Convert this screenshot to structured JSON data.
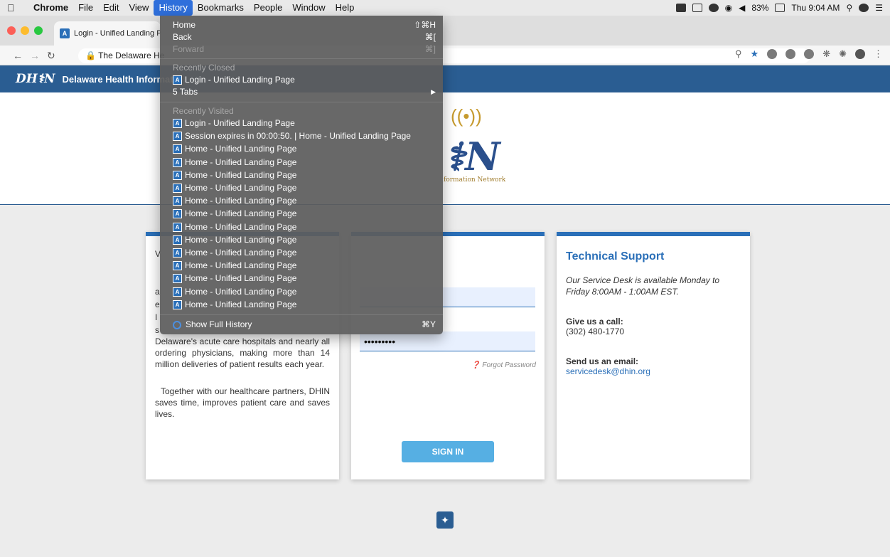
{
  "menubar": {
    "app": "Chrome",
    "items": [
      "File",
      "Edit",
      "View",
      "History",
      "Bookmarks",
      "People",
      "Window",
      "Help"
    ],
    "battery": "83%",
    "clock": "Thu 9:04 AM"
  },
  "tab": {
    "favicon": "A",
    "title": "Login - Unified Landing Page"
  },
  "omnibox": {
    "text": "The Delaware He"
  },
  "site": {
    "logo_small": "DH⚕N",
    "name": "Delaware Health Informati",
    "logo_big": "⚕N",
    "logo_sub": "formation Network"
  },
  "left_card": {
    "lines": [
      "a",
      "e",
      "I",
      "s"
    ],
    "p1": "Delaware's acute care hospitals and nearly all ordering physicians, making more than 14 million deliveries of patient results each year.",
    "p2": "Together with our healthcare partners, DHIN saves time, improves patient care and saves lives."
  },
  "login": {
    "password": "•••••••••",
    "forgot": "Forgot Password",
    "signin": "SIGN IN"
  },
  "support": {
    "title": "Technical Support",
    "hours": "Our Service Desk is available Monday to Friday 8:00AM - 1:00AM EST.",
    "call_label": "Give us a call:",
    "phone": "(302) 480-1770",
    "email_label": "Send us an email:",
    "email": "servicedesk@dhin.org"
  },
  "history_menu": {
    "home": {
      "label": "Home",
      "shortcut": "⇧⌘H"
    },
    "back": {
      "label": "Back",
      "shortcut": "⌘["
    },
    "forward": {
      "label": "Forward",
      "shortcut": "⌘]"
    },
    "recently_closed_header": "Recently Closed",
    "recently_closed": [
      "Login - Unified Landing Page"
    ],
    "tabs_group": "5 Tabs",
    "recently_visited_header": "Recently Visited",
    "recently_visited": [
      "Login - Unified Landing Page",
      "Session expires in 00:00:50. | Home - Unified Landing Page",
      "Home - Unified Landing Page",
      "Home - Unified Landing Page",
      "Home - Unified Landing Page",
      "Home - Unified Landing Page",
      "Home - Unified Landing Page",
      "Home - Unified Landing Page",
      "Home - Unified Landing Page",
      "Home - Unified Landing Page",
      "Home - Unified Landing Page",
      "Home - Unified Landing Page",
      "Home - Unified Landing Page",
      "Home - Unified Landing Page",
      "Home - Unified Landing Page"
    ],
    "show_full": {
      "label": "Show Full History",
      "shortcut": "⌘Y"
    }
  }
}
